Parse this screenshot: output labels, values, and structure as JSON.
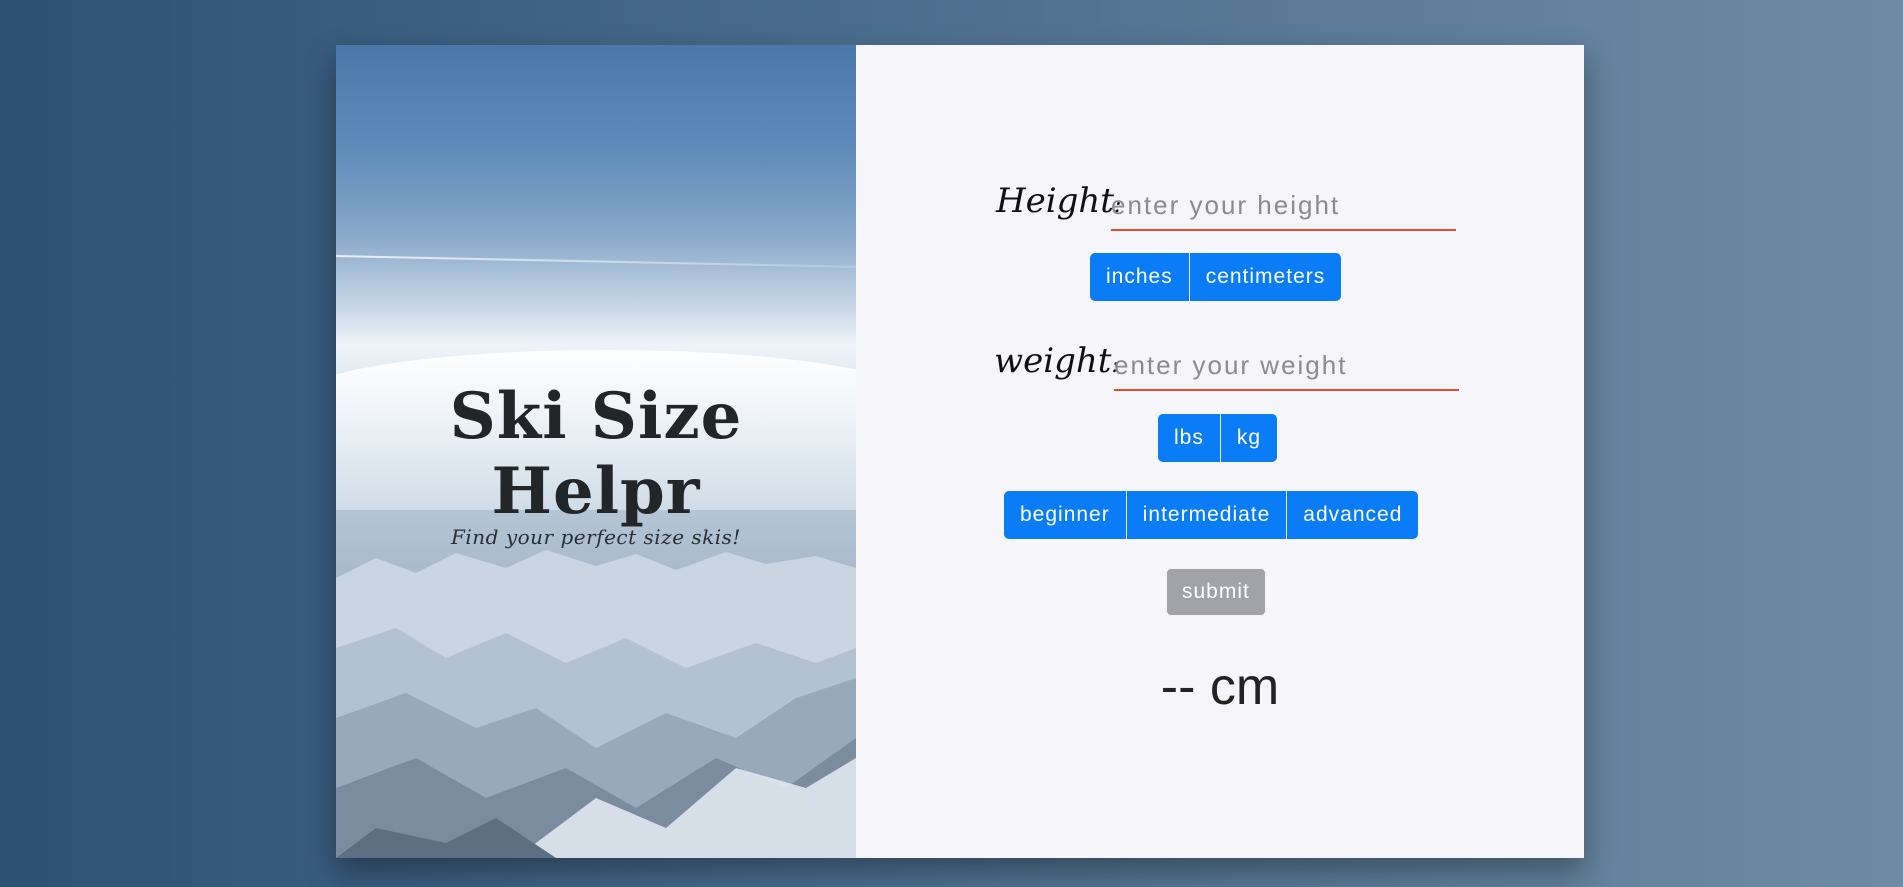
{
  "hero": {
    "title": "Ski Size Helpr",
    "subtitle": "Find your perfect size skis!"
  },
  "height": {
    "label": "Height",
    "placeholder": "enter your height",
    "units": [
      "inches",
      "centimeters"
    ]
  },
  "weight": {
    "label": "weight",
    "placeholder": "enter your weight",
    "units": [
      "lbs",
      "kg"
    ]
  },
  "level": {
    "options": [
      "beginner",
      "intermediate",
      "advanced"
    ]
  },
  "submit_label": "submit",
  "result": "-- cm",
  "colors": {
    "button": "#0a7cf6",
    "submit": "#a1a3a8",
    "underline": "#e0502e",
    "panel": "#f5f5fa"
  }
}
